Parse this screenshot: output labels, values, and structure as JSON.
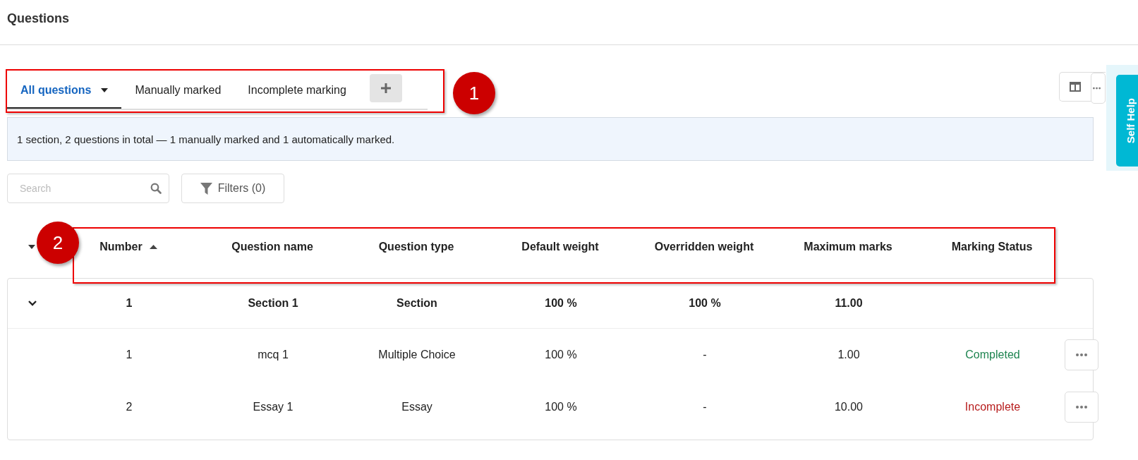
{
  "page": {
    "title": "Questions"
  },
  "tabs": [
    {
      "label": "All questions",
      "selected": true,
      "has_menu": true
    },
    {
      "label": "Manually marked",
      "selected": false,
      "has_menu": false
    },
    {
      "label": "Incomplete marking",
      "selected": false,
      "has_menu": false
    }
  ],
  "summary": "1 section, 2 questions in total — 1 manually marked and 1 automatically marked.",
  "search": {
    "placeholder": "Search"
  },
  "filters_button": "Filters (0)",
  "self_help": "Self Help",
  "table": {
    "columns": [
      {
        "label": "Number",
        "sorted": true
      },
      {
        "label": "Question name",
        "sorted": false
      },
      {
        "label": "Question type",
        "sorted": false
      },
      {
        "label": "Default weight",
        "sorted": false
      },
      {
        "label": "Overridden weight",
        "sorted": false
      },
      {
        "label": "Maximum marks",
        "sorted": false
      },
      {
        "label": "Marking Status",
        "sorted": false
      }
    ],
    "rows": [
      {
        "kind": "section",
        "expanded": true,
        "cells": [
          "1",
          "Section 1",
          "Section",
          "100 %",
          "100 %",
          "11.00"
        ]
      },
      {
        "kind": "question",
        "cells": [
          "1",
          "mcq 1",
          "Multiple Choice",
          "100 %",
          "-",
          "1.00"
        ],
        "status": {
          "text": "Completed",
          "color": "#1e8450"
        }
      },
      {
        "kind": "question",
        "cells": [
          "2",
          "Essay 1",
          "Essay",
          "100 %",
          "-",
          "10.00"
        ],
        "status": {
          "text": "Incomplete",
          "color": "#b71c1c"
        }
      }
    ]
  },
  "annotations": [
    {
      "number": "1"
    },
    {
      "number": "2"
    }
  ]
}
